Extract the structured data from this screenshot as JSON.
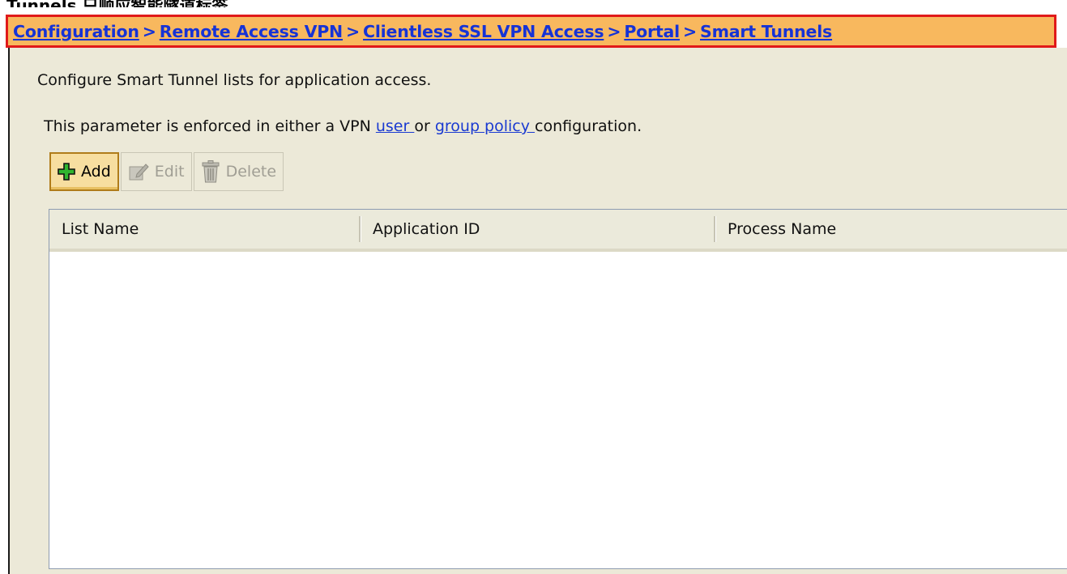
{
  "top_clipped_text": "Tunnels 只顺应智能隧道标签。",
  "breadcrumb": {
    "items": [
      "Configuration",
      "Remote Access VPN",
      "Clientless SSL VPN Access",
      "Portal",
      "Smart Tunnels"
    ],
    "separator": ">"
  },
  "description": "Configure Smart Tunnel lists for application access.",
  "enforcement": {
    "prefix": "This parameter is enforced in either a VPN ",
    "user_link": "user ",
    "middle": " or ",
    "group_link": "group policy ",
    "suffix": "configuration."
  },
  "toolbar": {
    "add_label": "Add",
    "edit_label": "Edit",
    "delete_label": "Delete"
  },
  "table": {
    "columns": [
      "List Name",
      "Application ID",
      "Process Name"
    ],
    "rows": []
  },
  "colors": {
    "breadcrumb_bg": "#f8b85e",
    "breadcrumb_border": "#e01a1a",
    "link": "#1633d6",
    "panel_bg": "#ece9d8",
    "add_icon": "#2fb52f"
  },
  "icons": {
    "add": "plus-icon",
    "edit": "edit-icon",
    "delete": "trash-icon"
  }
}
